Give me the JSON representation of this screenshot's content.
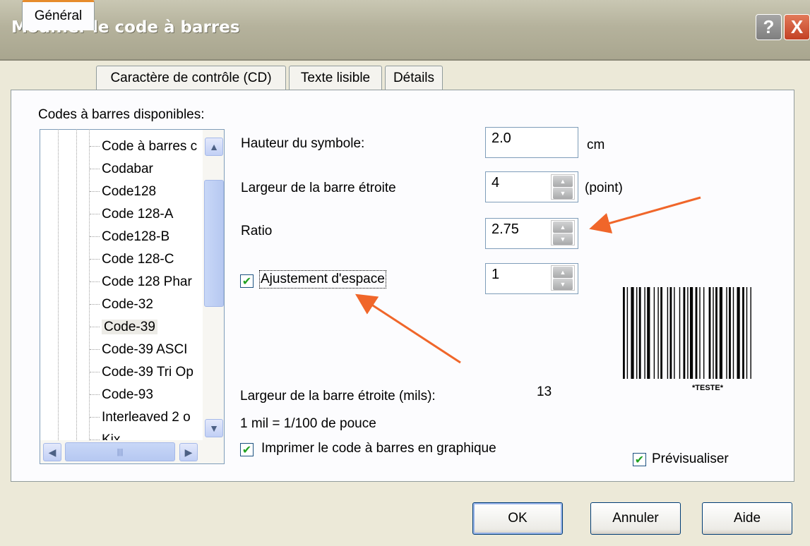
{
  "window": {
    "title": "Modifier le code à barres",
    "help_glyph": "?",
    "close_glyph": "X"
  },
  "tabs": [
    {
      "label": "Général",
      "active": true
    },
    {
      "label": "Caractère de contrôle (CD)",
      "active": false
    },
    {
      "label": "Texte lisible",
      "active": false
    },
    {
      "label": "Détails",
      "active": false
    }
  ],
  "tree": {
    "heading": "Codes à barres disponibles:",
    "items": [
      "Code à barres c",
      "Codabar",
      "Code128",
      "Code 128-A",
      "Code128-B",
      "Code 128-C",
      "Code 128 Phar",
      "Code-32",
      "Code-39",
      "Code-39 ASCI",
      "Code-39 Tri Op",
      "Code-93",
      "Interleaved 2 o",
      "Kix"
    ],
    "selected": "Code-39"
  },
  "form": {
    "hauteur_label": "Hauteur du symbole:",
    "hauteur_value": "2.0",
    "hauteur_unit": "cm",
    "largeur_label": "Largeur de la barre étroite",
    "largeur_value": "4",
    "largeur_unit": "(point)",
    "ratio_label": "Ratio",
    "ratio_value": "2.75",
    "ajustement_label": "Ajustement d'espace",
    "ajustement_checked": true,
    "ajustement_value": "1",
    "mils_label": "Largeur de la barre étroite (mils):",
    "mils_value": "13",
    "mil_note": "1 mil = 1/100 de pouce",
    "imprimer_label": "Imprimer le code à barres en graphique",
    "imprimer_checked": true,
    "preview_label": "Prévisualiser",
    "preview_checked": true
  },
  "preview": {
    "caption": "*TESTE*"
  },
  "buttons": {
    "ok": "OK",
    "cancel": "Annuler",
    "help": "Aide"
  },
  "colors": {
    "arrow": "#f0662a",
    "check": "#21a121",
    "tab_accent": "#e68b2c"
  }
}
